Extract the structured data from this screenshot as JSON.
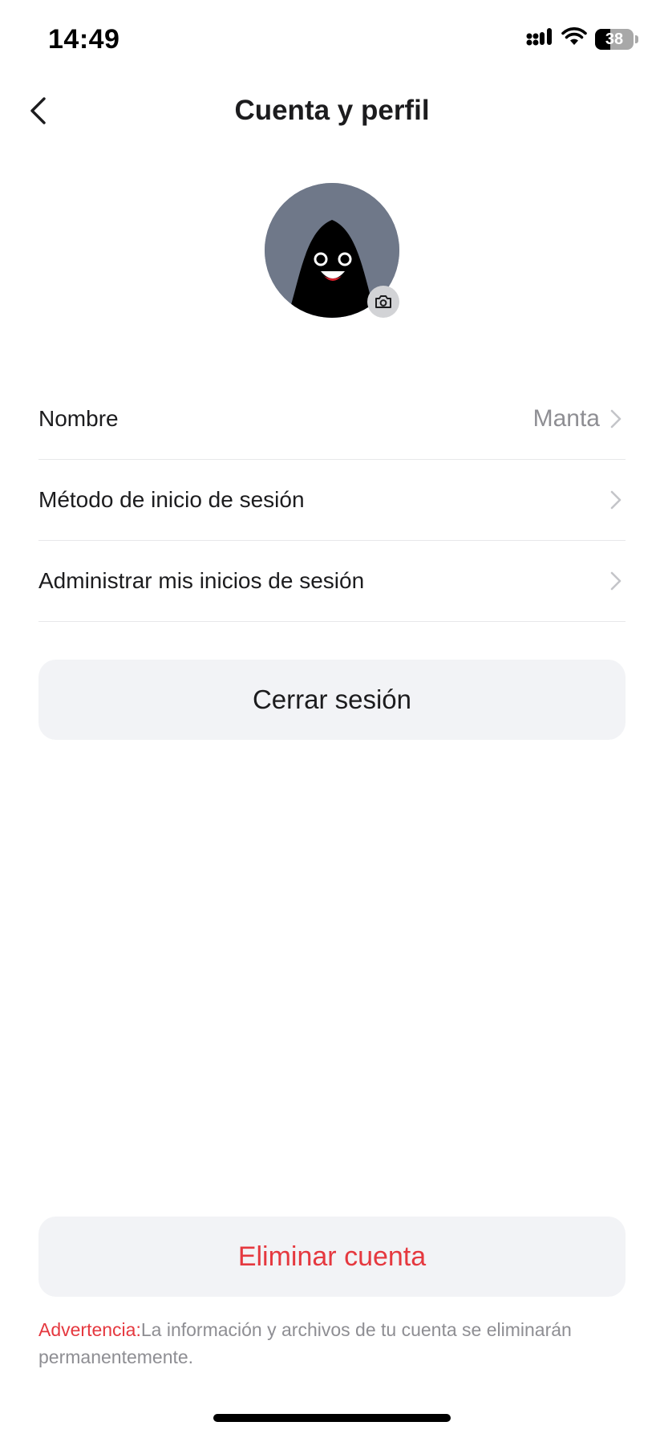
{
  "status_bar": {
    "time": "14:49",
    "battery_level": "38",
    "icons": [
      "signal-icon",
      "wifi-icon",
      "battery-icon"
    ]
  },
  "header": {
    "title": "Cuenta y perfil",
    "back_icon": "chevron-left-icon"
  },
  "avatar": {
    "badge_icon": "camera-icon",
    "background_color": "#6f7889"
  },
  "settings": {
    "items": [
      {
        "label": "Nombre",
        "value": "Manta"
      },
      {
        "label": "Método de inicio de sesión",
        "value": ""
      },
      {
        "label": "Administrar mis inicios de sesión",
        "value": ""
      }
    ]
  },
  "actions": {
    "logout_label": "Cerrar sesión",
    "delete_label": "Eliminar cuenta"
  },
  "warning": {
    "prefix": "Advertencia:",
    "text": "La información y archivos de tu cuenta se eliminarán permanentemente."
  },
  "colors": {
    "danger": "#e5383f",
    "button_bg": "#f2f3f6",
    "secondary_text": "#8e8e93"
  }
}
